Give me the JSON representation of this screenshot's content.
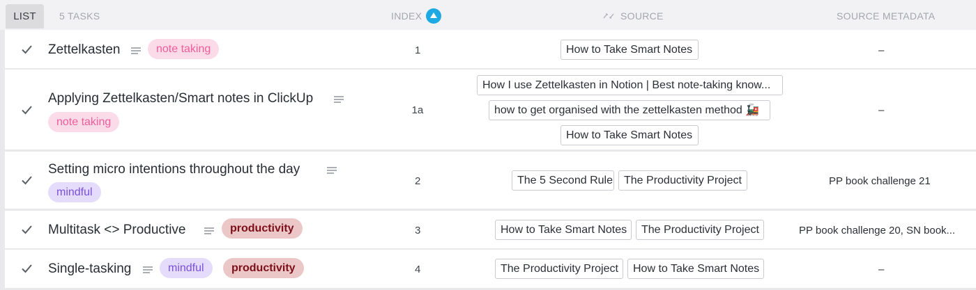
{
  "header": {
    "list_tab": "LIST",
    "task_count": "5 TASKS",
    "col_index": "INDEX",
    "col_source": "SOURCE",
    "col_source_metadata": "SOURCE METADATA"
  },
  "colors": {
    "sort_badge": "#1fa9e3",
    "tag_note_taking": "#fbdbe8",
    "tag_mindful": "#e5dcfb",
    "tag_productivity": "#ecc7c7"
  },
  "tasks": [
    {
      "title": "Zettelkasten",
      "tags": [
        "note taking"
      ],
      "index": "1",
      "sources": [
        "How to Take Smart Notes"
      ],
      "metadata": "–"
    },
    {
      "title": "Applying Zettelkasten/Smart notes in ClickUp",
      "tags": [
        "note taking"
      ],
      "index": "1a",
      "sources": [
        "How I use Zettelkasten in Notion | Best note-taking know...",
        "how to get organised with the zettelkasten method 🚂",
        "How to Take Smart Notes"
      ],
      "metadata": "–"
    },
    {
      "title": "Setting micro intentions throughout the day",
      "tags": [
        "mindful"
      ],
      "index": "2",
      "sources": [
        "The 5 Second Rule",
        "The Productivity Project"
      ],
      "metadata": "PP book challenge 21"
    },
    {
      "title": "Multitask <> Productive",
      "tags": [
        "productivity"
      ],
      "index": "3",
      "sources": [
        "How to Take Smart Notes",
        "The Productivity Project"
      ],
      "metadata": "PP book challenge 20, SN book..."
    },
    {
      "title": "Single-tasking",
      "tags": [
        "mindful",
        "productivity"
      ],
      "index": "4",
      "sources": [
        "The Productivity Project",
        "How to Take Smart Notes"
      ],
      "metadata": "–"
    }
  ]
}
